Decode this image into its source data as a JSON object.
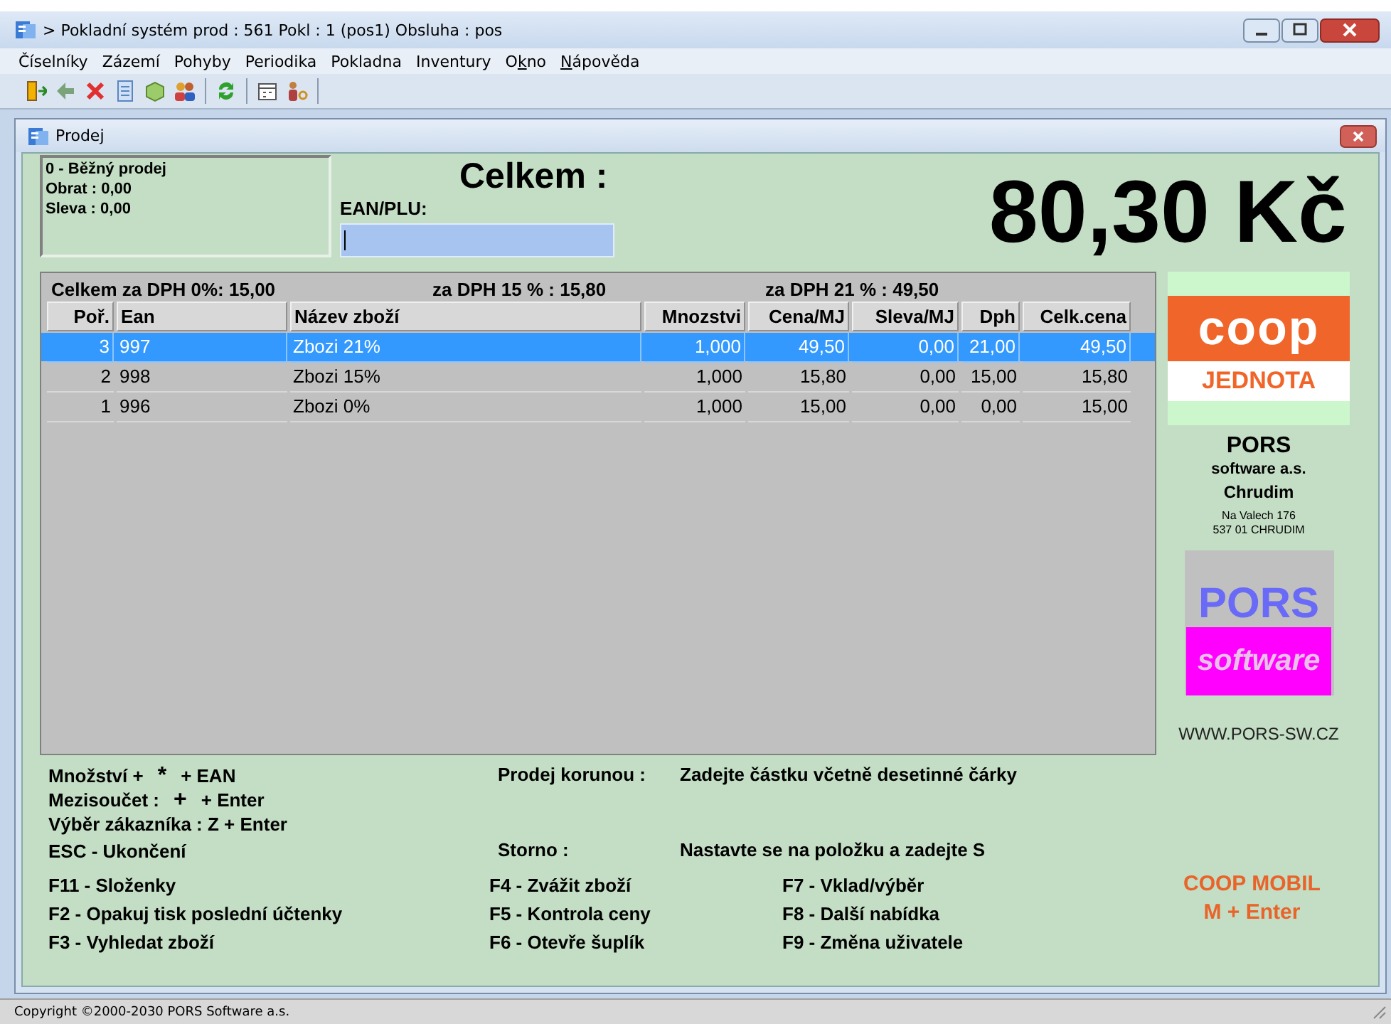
{
  "window": {
    "title": "> Pokladní systém prod : 561 Pokl : 1 (pos1) Obsluha : pos"
  },
  "menu": [
    {
      "after": "Číselníky"
    },
    {
      "after": "Zázemí"
    },
    {
      "after": "Pohyby"
    },
    {
      "after": "Periodika"
    },
    {
      "after": "Pokladna"
    },
    {
      "after": "Inventury"
    },
    {
      "before": "O",
      "key": "k",
      "after": "no"
    },
    {
      "key": "N",
      "after": "ápověda"
    }
  ],
  "child_window": {
    "title": "Prodej"
  },
  "info": [
    "0 - Běžný prodej",
    "Obrat : 0,00",
    "Sleva : 0,00"
  ],
  "total_label": "Celkem :",
  "ean_field": {
    "label": "EAN/PLU:",
    "focused": true
  },
  "total": "80,30 Kč",
  "vat_summary": [
    "Celkem za DPH 0%: 15,00",
    "za DPH 15 % : 15,80",
    "za DPH 21 % : 49,50"
  ],
  "table": {
    "columns": [
      {
        "label": "Poř.",
        "kind": "numeric"
      },
      {
        "label": "Ean",
        "kind": "text"
      },
      {
        "label": "Název zboží",
        "kind": "text"
      },
      {
        "label": "Mnozstvi",
        "kind": "numeric"
      },
      {
        "label": "Cena/MJ",
        "kind": "numeric"
      },
      {
        "label": "Sleva/MJ",
        "kind": "numeric"
      },
      {
        "label": "Dph",
        "kind": "numeric"
      },
      {
        "label": "Celk.cena",
        "kind": "numeric"
      }
    ],
    "rows": [
      {
        "selected": true,
        "cells": [
          "3",
          "997",
          "Zbozi 21%",
          "1,000",
          "49,50",
          "0,00",
          "21,00",
          "49,50"
        ]
      },
      {
        "selected": false,
        "cells": [
          "2",
          "998",
          "Zbozi 15%",
          "1,000",
          "15,80",
          "0,00",
          "15,00",
          "15,80"
        ]
      },
      {
        "selected": false,
        "cells": [
          "1",
          "996",
          "Zbozi 0%",
          "1,000",
          "15,00",
          "0,00",
          "0,00",
          "15,00"
        ]
      }
    ]
  },
  "sidebar": {
    "coop_logo": {
      "word": "coop",
      "subtitle": "JEDNOTA"
    },
    "company": "PORS",
    "company_sub": "software a.s.",
    "city": "Chrudim",
    "address": [
      "Na Valech 176",
      "537 01 CHRUDIM"
    ],
    "pors_logo": {
      "word": "PORS",
      "subtitle": "software"
    },
    "website": "WWW.PORS-SW.CZ"
  },
  "shortcuts": [
    [
      {
        "text": "Množství +"
      },
      {
        "key": "*"
      },
      {
        "text": "+ EAN"
      }
    ],
    [
      {
        "text": "Mezisoučet :"
      },
      {
        "key": "+"
      },
      {
        "text": "+ Enter"
      }
    ],
    [
      {
        "text": "Výběr zákazníka : Z + Enter"
      }
    ],
    [
      {
        "text": "ESC - Ukončení"
      }
    ]
  ],
  "hints": [
    {
      "label": "Prodej korunou :",
      "text": "Zadejte částku včetně desetinné čárky"
    },
    {
      "label": "Storno :",
      "text": "Nastavte se na položku a zadejte S"
    }
  ],
  "function_keys": [
    [
      "F11 - Složenky",
      "F2 - Opakuj tisk poslední účtenky",
      "F3 - Vyhledat zboží"
    ],
    [
      "F4 - Zvážit zboží",
      "F5 - Kontrola ceny",
      "F6 - Otevře šuplík"
    ],
    [
      "F7 - Vklad/výběr",
      "F8 - Další nabídka",
      "F9 - Změna uživatele"
    ]
  ],
  "promo": [
    "COOP MOBIL",
    "M + Enter"
  ],
  "status_bar": "Copyright ©2000-2030 PORS Software a.s."
}
